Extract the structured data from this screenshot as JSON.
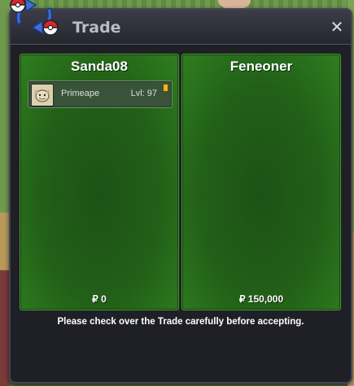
{
  "window": {
    "title": "Trade",
    "close_glyph": "✕"
  },
  "trade_icon": "trade-arrows-pokeball-icon",
  "panels": [
    {
      "player": "Sanda08",
      "money": "₽ 0",
      "items": [
        {
          "name": "Primeape",
          "level": "Lvl: 97",
          "sprite_icon": "primeape-sprite-icon"
        }
      ]
    },
    {
      "player": "Feneoner",
      "money": "₽ 150,000",
      "items": []
    }
  ],
  "notice": "Please check over the Trade carefully before accepting.",
  "colors": {
    "panel_green": "#226018",
    "panel_border": "#4a9a34",
    "window_bg": "#1f1f26",
    "title_text": "#b9bcc6"
  }
}
